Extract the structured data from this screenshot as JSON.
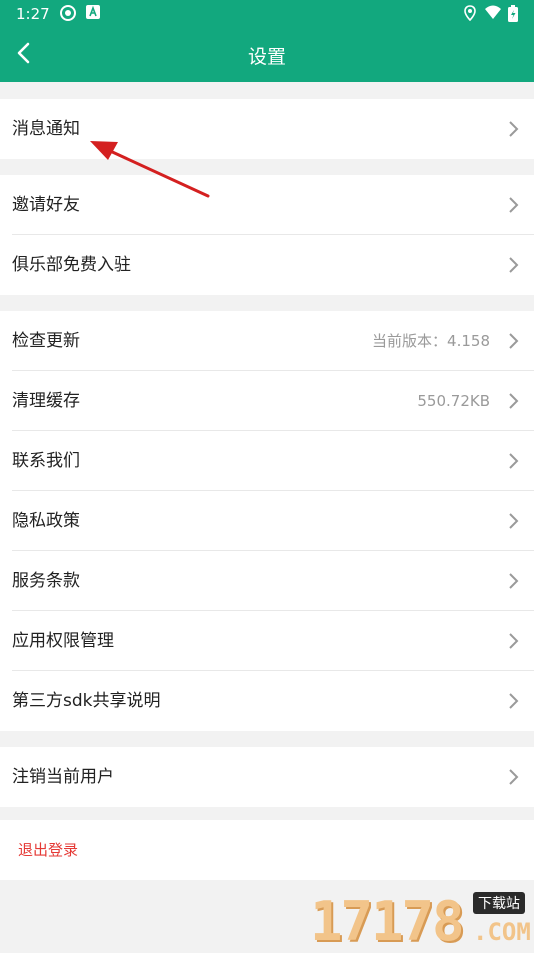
{
  "status_bar": {
    "time": "1:27"
  },
  "nav": {
    "title": "设置"
  },
  "groups": [
    {
      "items": [
        {
          "label": "消息通知"
        }
      ]
    },
    {
      "items": [
        {
          "label": "邀请好友"
        },
        {
          "label": "俱乐部免费入驻"
        }
      ]
    },
    {
      "items": [
        {
          "label": "检查更新",
          "value": "当前版本：4.158"
        },
        {
          "label": "清理缓存",
          "value": "550.72KB"
        },
        {
          "label": "联系我们"
        },
        {
          "label": "隐私政策"
        },
        {
          "label": "服务条款"
        },
        {
          "label": "应用权限管理"
        },
        {
          "label": "第三方sdk共享说明"
        }
      ]
    },
    {
      "items": [
        {
          "label": "注销当前用户"
        }
      ]
    }
  ],
  "logout_label": "退出登录",
  "watermark": {
    "number": "17178",
    "badge": "下载站",
    "domain": ".COM"
  },
  "colors": {
    "header": "#12a87e",
    "logout": "#e53935",
    "annotation_arrow": "#d42020"
  }
}
